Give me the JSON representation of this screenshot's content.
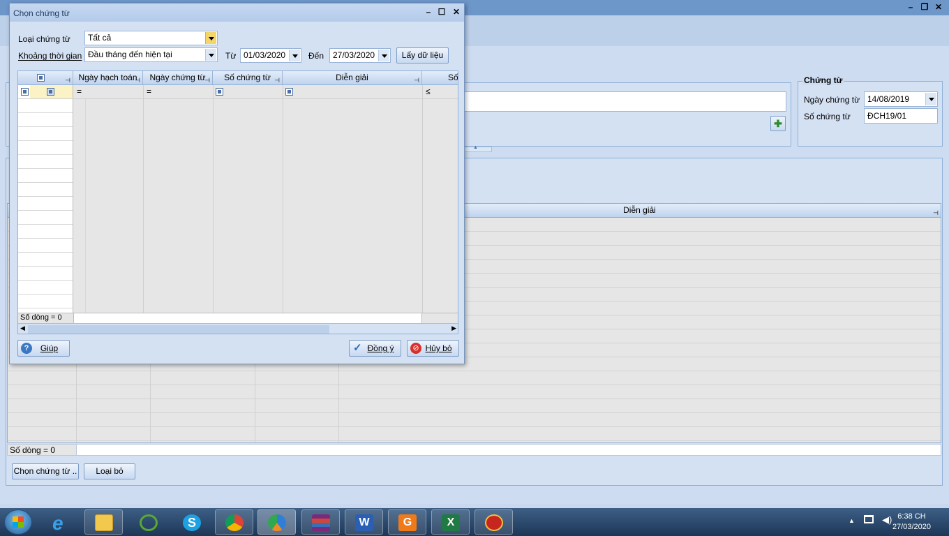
{
  "background": {
    "voucher_group": {
      "title": "Chứng từ",
      "date_label": "Ngày chứng từ",
      "date_value": "14/08/2019",
      "number_label": "Số chứng từ",
      "number_value": "ĐCH19/01"
    },
    "grid": {
      "description_header": "Diễn giải",
      "row_count": "Số dòng = 0"
    },
    "buttons": {
      "select_vouchers": "Chọn chứng từ ..",
      "remove": "Loại bỏ"
    }
  },
  "dialog": {
    "title": "Chọn chứng từ",
    "voucher_type_label": "Loại chứng từ",
    "voucher_type_value": "Tất cả",
    "period_label": "Khoảng thời gian",
    "period_value": "Đầu tháng đến hiện tại",
    "from_label": "Từ",
    "from_value": "01/03/2020",
    "to_label": "Đến",
    "to_value": "27/03/2020",
    "fetch_button": "Lấy dữ liệu",
    "columns": [
      "Ngày hạch toán",
      "Ngày chứng từ",
      "Số chứng từ",
      "Diễn giải",
      "Số"
    ],
    "filter_ops": [
      "=",
      "=",
      "≤"
    ],
    "row_count": "Số dòng = 0",
    "help_button": "Giúp",
    "ok_button": "Đồng ý",
    "cancel_button": "Hủy bỏ"
  },
  "taskbar": {
    "time": "6:38 CH",
    "date": "27/03/2020",
    "apps": [
      "internet-explorer",
      "file-explorer",
      "coccoc",
      "skype",
      "chrome",
      "app-blue",
      "winrar",
      "word",
      "foxit-pdf",
      "excel",
      "htkk"
    ]
  },
  "colors": {
    "accent": "#6d96c9",
    "panel": "#d4e1f3",
    "grid_bg": "#e6e6e6"
  }
}
